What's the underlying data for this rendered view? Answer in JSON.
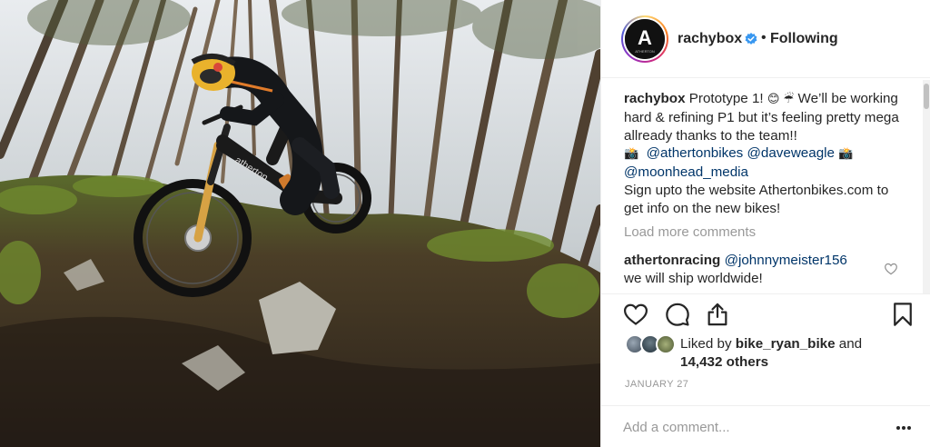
{
  "post": {
    "author": "rachybox",
    "separator": "•",
    "follow_status": "Following",
    "avatar_letter": "A",
    "avatar_word": "ATHERTON",
    "frame_brand_text": "atherton",
    "caption": {
      "username": "rachybox",
      "part1": " Prototype 1! ",
      "emoji1": "😊",
      "emoji2": "☔",
      "part2": "  We’ll be working hard & refining P1 but it’s feeling pretty mega allready thanks to the team!! ",
      "emoji3": "📸",
      "mention1": "@athertonbikes",
      "mention2": "@daveweagle",
      "emoji4": "📸",
      "mention3": "@moonhead_media",
      "part3": "Sign upto the website Athertonbikes.com to get info on the new bikes!"
    },
    "load_more": "Load more comments",
    "reply": {
      "username": "athertonracing",
      "mention": "@johnnymeister156",
      "text": "we will ship worldwide!"
    },
    "likes": {
      "prefix": "Liked by ",
      "user": "bike_ryan_bike",
      "connector": " and",
      "count": "14,432 others"
    },
    "date": "JANUARY 27",
    "add_comment_placeholder": "Add a comment...",
    "more_label": "•••"
  },
  "icons": {
    "verified": "verified-badge-icon",
    "like": "heart-icon",
    "comment": "comment-bubble-icon",
    "share": "share-icon",
    "save": "bookmark-icon",
    "reply_like": "small-heart-icon",
    "more": "more-options-icon"
  },
  "colors": {
    "text": "#262626",
    "secondary": "#999999",
    "mention": "#003569",
    "verified": "#3897f0",
    "border": "#efefef"
  }
}
